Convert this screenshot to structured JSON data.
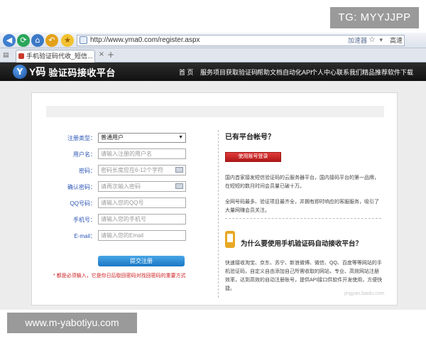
{
  "overlay": {
    "tag": "TG: MYYJJPP",
    "site": "www.m-yabotiyu.com"
  },
  "browser": {
    "address": "http://www.yma0.com/register.aspx",
    "accelerator": "加速器",
    "compat_label": "高速",
    "tab_title": "手机验证码代收_短信...",
    "tab_close": "×",
    "tab_new": "+"
  },
  "site": {
    "logo_y": "Y码",
    "logo_text": "验证码接收平台",
    "nav": [
      "首 页",
      "服务项目",
      "获取验证码",
      "帮助文档",
      "自动化API",
      "个人中心",
      "联系我们",
      "精品推荐",
      "软件下载"
    ]
  },
  "form": {
    "fields": [
      {
        "label": "注册类型：",
        "type": "select",
        "value": "普通用户"
      },
      {
        "label": "用户名：",
        "type": "text",
        "placeholder": "请输入注册的用户名"
      },
      {
        "label": "密码：",
        "type": "password",
        "placeholder": "密码长度应在6-12个字符"
      },
      {
        "label": "确认密码：",
        "type": "password",
        "placeholder": "请再次输入密码"
      },
      {
        "label": "QQ号码：",
        "type": "text",
        "placeholder": "请输入您的QQ号"
      },
      {
        "label": "手机号：",
        "type": "text",
        "placeholder": "请输入您的手机号"
      },
      {
        "label": "E-mail：",
        "type": "text",
        "placeholder": "请输入您的Email"
      }
    ],
    "submit": "提交注册",
    "required_note": "* 都是必须输入，它是你日后取回密码对找回密码的重要方式"
  },
  "aside": {
    "has_account": "已有平台帐号？",
    "login_button": "使用账号登录",
    "para1": "国内首家接发短信验证码的云服务器平台，国内接码平台的第一品牌，在短短的数月时间会员量已破十万。",
    "para2": "全网号码最多、验证项目最齐全，并拥有即时响应的客服服务，吸引了大量网赚会员关注。",
    "why_title": "为什么要使用手机验证码自动接收平台？",
    "para3": "快速接收淘宝、京东、苏宁、新浪微博、微信、QQ、百度等等网站的手机验证码，自定义自由添加自己所需收取的网站，专业、高效网站注册效率，达到高效的自动注册账号，提供API接口供软件开发使用，方便快捷。",
    "watermark": "jingyan.baidu.com"
  }
}
